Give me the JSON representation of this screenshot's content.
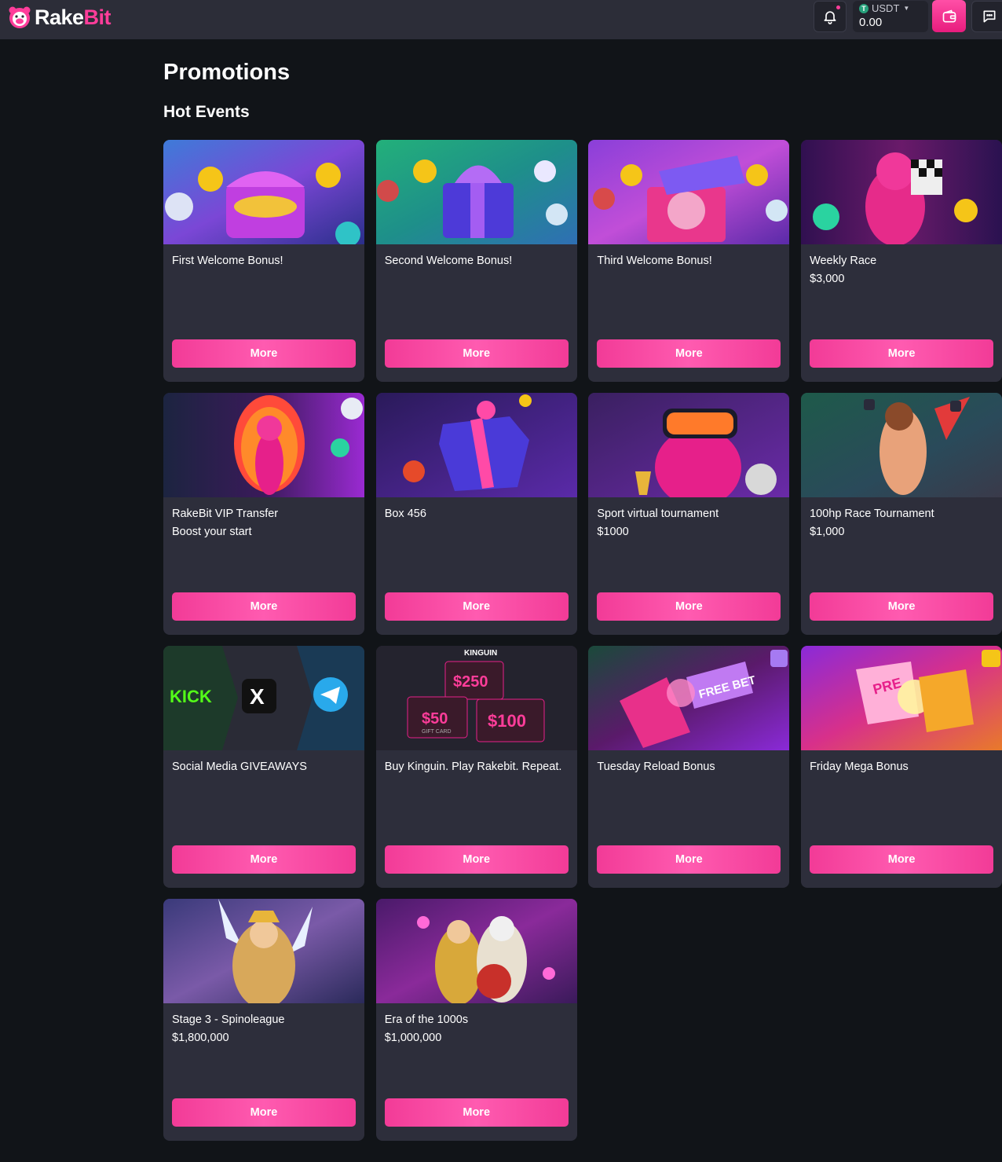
{
  "header": {
    "logo_main": "Rake",
    "logo_accent": "Bit",
    "currency": "USDT",
    "currency_symbol": "T",
    "balance": "0.00"
  },
  "page": {
    "title": "Promotions",
    "section_title": "Hot Events"
  },
  "colors": {
    "accent": "#ff3d9a",
    "card_bg": "#2d2e3b",
    "page_bg": "#111418",
    "header_bg": "#2c2d38"
  },
  "cards": [
    {
      "title": "First Welcome Bonus!",
      "subtitle": "",
      "button": "More",
      "image": "treasure-chest-image"
    },
    {
      "title": "Second Welcome Bonus!",
      "subtitle": "",
      "button": "More",
      "image": "gift-box-image"
    },
    {
      "title": "Third Welcome Bonus!",
      "subtitle": "",
      "button": "More",
      "image": "open-gift-box-image"
    },
    {
      "title": "Weekly Race",
      "subtitle": "$3,000",
      "button": "More",
      "image": "racing-bear-image"
    },
    {
      "title": "RakeBit VIP Transfer",
      "subtitle": "Boost your start",
      "button": "More",
      "image": "vip-bear-image"
    },
    {
      "title": "Box 456",
      "subtitle": "",
      "button": "More",
      "image": "mystery-box-image"
    },
    {
      "title": "Sport virtual tournament",
      "subtitle": "$1000",
      "button": "More",
      "image": "vr-bear-image"
    },
    {
      "title": "100hp Race Tournament",
      "subtitle": "$1,000",
      "button": "More",
      "image": "racer-girl-image"
    },
    {
      "title": "Social Media GIVEAWAYS",
      "subtitle": "",
      "button": "More",
      "image": "social-logos-image"
    },
    {
      "title": "Buy Kinguin. Play Rakebit. Repeat.",
      "subtitle": "",
      "button": "More",
      "image": "gift-cards-image"
    },
    {
      "title": "Tuesday Reload Bonus",
      "subtitle": "",
      "button": "More",
      "image": "free-bet-slot-image"
    },
    {
      "title": "Friday Mega Bonus",
      "subtitle": "",
      "button": "More",
      "image": "mega-slot-image"
    },
    {
      "title": "Stage 3 - Spinoleague",
      "subtitle": "$1,800,000",
      "button": "More",
      "image": "goddess-image"
    },
    {
      "title": "Era of the 1000s",
      "subtitle": "$1,000,000",
      "button": "More",
      "image": "zeus-image"
    }
  ],
  "image_text": {
    "kick": "KICK",
    "kinguin": "KINGUIN",
    "gc250": "$250",
    "gc50": "$50",
    "gc100": "$100",
    "gift_card": "GIFT CARD",
    "free_bet": "FREE BET",
    "pre": "PRE"
  }
}
